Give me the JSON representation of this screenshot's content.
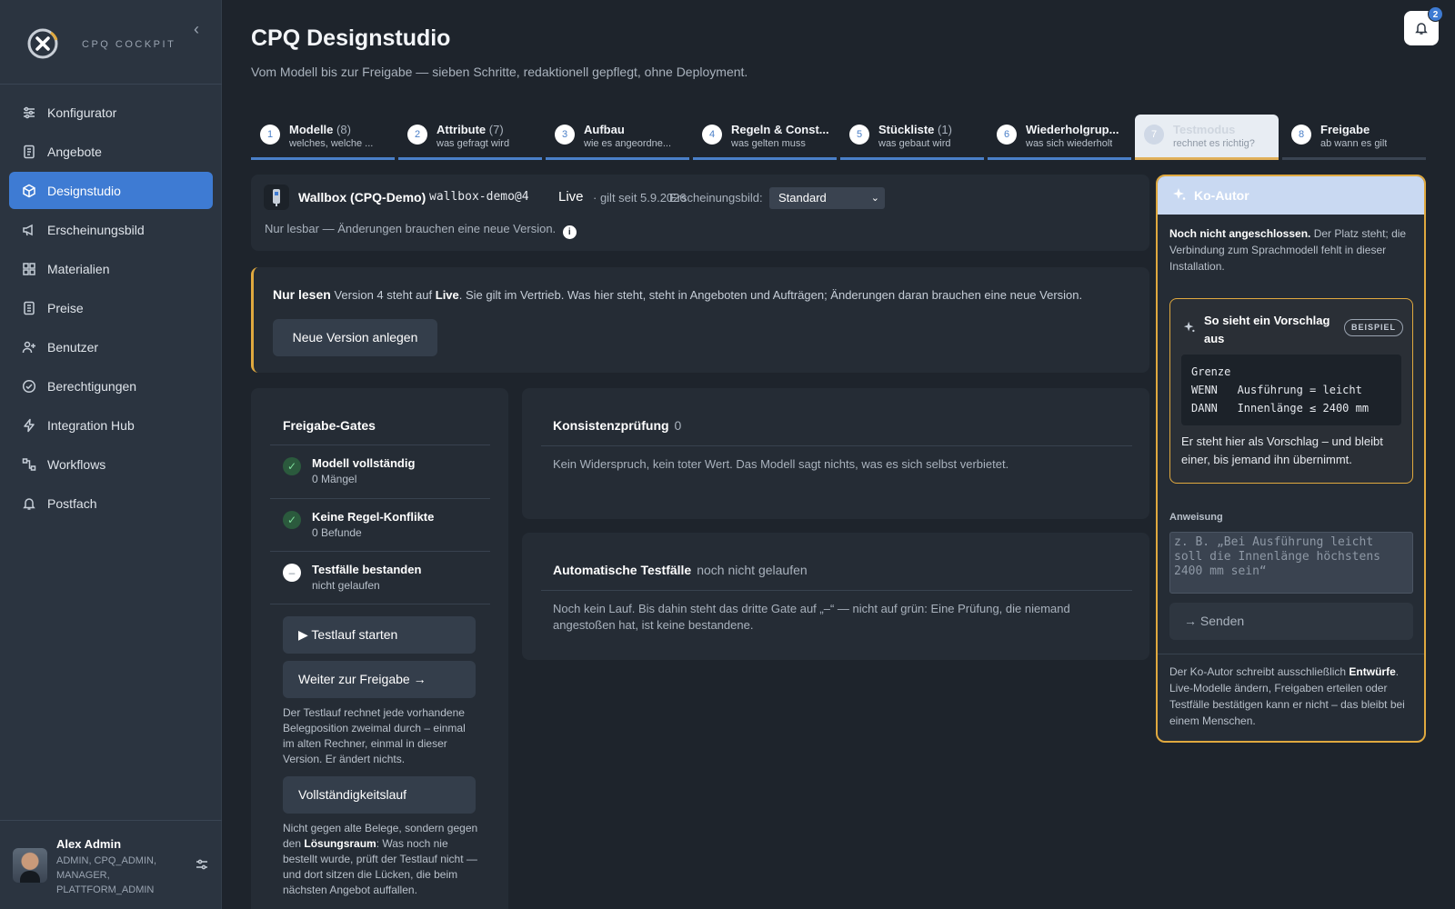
{
  "brand": {
    "name": "CPQ COCKPIT"
  },
  "nav": {
    "items": [
      {
        "label": "Konfigurator",
        "icon": "sliders-icon",
        "active": false
      },
      {
        "label": "Angebote",
        "icon": "document-icon",
        "active": false
      },
      {
        "label": "Designstudio",
        "icon": "cube-icon",
        "active": true
      },
      {
        "label": "Erscheinungsbild",
        "icon": "megaphone-icon",
        "active": false
      },
      {
        "label": "Materialien",
        "icon": "grid-icon",
        "active": false
      },
      {
        "label": "Preise",
        "icon": "receipt-icon",
        "active": false
      },
      {
        "label": "Benutzer",
        "icon": "user-plus-icon",
        "active": false
      },
      {
        "label": "Berechtigungen",
        "icon": "check-circle-icon",
        "active": false
      },
      {
        "label": "Integration Hub",
        "icon": "bolt-icon",
        "active": false
      },
      {
        "label": "Workflows",
        "icon": "workflow-icon",
        "active": false
      },
      {
        "label": "Postfach",
        "icon": "bell-icon",
        "active": false
      }
    ]
  },
  "user": {
    "name": "Alex Admin",
    "roles": "ADMIN, CPQ_ADMIN, MANAGER, PLATTFORM_ADMIN"
  },
  "header": {
    "title": "CPQ Designstudio",
    "subtitle": "Vom Modell bis zur Freigabe — sieben Schritte, redaktionell gepflegt, ohne Deployment.",
    "notification_count": "2"
  },
  "steps": [
    {
      "num": "1",
      "title": "Modelle",
      "count": "(8)",
      "sub": "welches, welche ..."
    },
    {
      "num": "2",
      "title": "Attribute",
      "count": "(7)",
      "sub": "was gefragt wird"
    },
    {
      "num": "3",
      "title": "Aufbau",
      "count": "",
      "sub": "wie es angeordne..."
    },
    {
      "num": "4",
      "title": "Regeln & Const...",
      "count": "",
      "sub": "was gelten muss"
    },
    {
      "num": "5",
      "title": "Stückliste",
      "count": "(1)",
      "sub": "was gebaut wird"
    },
    {
      "num": "6",
      "title": "Wiederholgrup...",
      "count": "",
      "sub": "was sich wiederholt"
    },
    {
      "num": "7",
      "title": "Testmodus",
      "count": "",
      "sub": "rechnet es richtig?",
      "active": true
    },
    {
      "num": "8",
      "title": "Freigabe",
      "count": "",
      "sub": "ab wann es gilt"
    }
  ],
  "model": {
    "name": "Wallbox (CPQ-Demo)",
    "code": "wallbox-demo@4",
    "status": "Live",
    "since": "· gilt seit 5.9.2026",
    "appearance_label": "Erscheinungsbild:",
    "appearance_value": "Standard",
    "readonly_note": "Nur lesbar — Änderungen brauchen eine neue Version."
  },
  "banner": {
    "title": "Nur lesen",
    "text_1": "Version 4 steht auf",
    "status": "Live",
    "text_2": ". Sie gilt im Vertrieb. Was hier steht, steht in Angeboten und Aufträgen; Änderungen daran brauchen eine neue Version.",
    "button": "Neue Version anlegen"
  },
  "gates": {
    "title": "Freigabe-Gates",
    "items": [
      {
        "title": "Modell vollständig",
        "sub": "0 Mängel",
        "state": "ok",
        "mark": "✓"
      },
      {
        "title": "Keine Regel-Konflikte",
        "sub": "0 Befunde",
        "state": "ok",
        "mark": "✓"
      },
      {
        "title": "Testfälle bestanden",
        "sub": "nicht gelaufen",
        "state": "pending",
        "mark": "–"
      }
    ],
    "run_button": "▶ Testlauf starten",
    "next_button": "Weiter zur Freigabe →",
    "run_note": "Der Testlauf rechnet jede vorhandene Belegposition zweimal durch – einmal im alten Rechner, einmal in dieser Version. Er ändert nichts.",
    "full_button": "Vollständigkeitslauf",
    "full_note_1": "Nicht gegen alte Belege, sondern gegen den",
    "full_note_bold": "Lösungsraum",
    "full_note_2": ": Was noch nie bestellt wurde, prüft der Testlauf nicht — und dort sitzen die Lücken, die beim nächsten Angebot auffallen."
  },
  "consistency": {
    "title": "Konsistenzprüfung",
    "count": "0",
    "text": "Kein Widerspruch, kein toter Wert. Das Modell sagt nichts, was es sich selbst verbietet."
  },
  "autotests": {
    "title": "Automatische Testfälle",
    "status": "noch nicht gelaufen",
    "text": "Noch kein Lauf. Bis dahin steht das dritte Gate auf „–“ — nicht auf grün: Eine Prüfung, die niemand angestoßen hat, ist keine bestandene."
  },
  "coauthor": {
    "title": "Ko-Autor",
    "intro_bold": "Noch nicht angeschlossen.",
    "intro": " Der Platz steht; die Verbindung zum Sprachmodell fehlt in dieser Installation.",
    "example_title": "So sieht ein Vorschlag aus",
    "example_badge": "BEISPIEL",
    "example_code": "Grenze\nWENN   Ausführung = leicht\nDANN   Innenlänge ≤ 2400 mm",
    "example_foot": "Er steht hier als Vorschlag – und bleibt einer, bis jemand ihn übernimmt.",
    "input_label": "Anweisung",
    "input_placeholder": "z. B. „Bei Ausführung leicht soll die Innenlänge höchstens 2400 mm sein“",
    "send_button": "→ Senden",
    "foot_1": "Der Ko-Autor schreibt ausschließlich",
    "foot_bold": "Entwürfe",
    "foot_2": ". Live-Modelle ändern, Freigaben erteilen oder Testfälle bestätigen kann er nicht – das bleibt bei einem Menschen."
  },
  "colors": {
    "accent": "#3e7bd3",
    "warning": "#e0a93f",
    "success": "#7ddc9a",
    "background": "#1e242c",
    "sidebar": "#2b3440"
  }
}
